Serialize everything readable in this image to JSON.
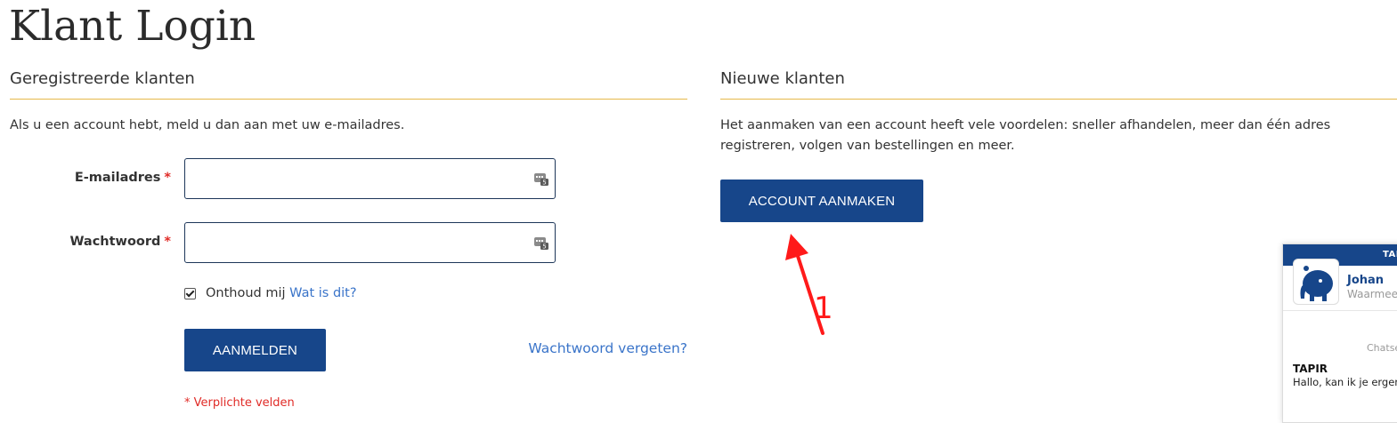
{
  "page": {
    "title": "Klant Login"
  },
  "registered": {
    "heading": "Geregistreerde klanten",
    "intro": "Als u een account hebt, meld u dan aan met uw e-mailadres.",
    "email_label": "E-mailadres",
    "password_label": "Wachtwoord",
    "required_mark": "*",
    "email_value": "",
    "password_value": "",
    "remember_label": "Onthoud mij",
    "remember_checked": true,
    "whats_this_link": "Wat is dit?",
    "login_button": "Aanmelden",
    "forgot_link": "Wachtwoord vergeten?",
    "required_note": "* Verplichte velden"
  },
  "new_customers": {
    "heading": "Nieuwe klanten",
    "intro": "Het aanmaken van een account heeft vele voordelen: sneller afhandelen, meer dan één adres registreren, volgen van bestellingen en meer.",
    "create_button": "Account aanmaken"
  },
  "annotation": {
    "label": "1",
    "color": "#ff1a1a"
  },
  "chat": {
    "header": "TAPIR",
    "agent_name": "Johan",
    "agent_subtitle": "Waarmee kan ik je helpen?",
    "timestamp": "Chatsessie gestart",
    "sender": "TAPIR",
    "message": "Hallo, kan ik je ergens mee helpen?"
  },
  "colors": {
    "accent": "#17468a",
    "divider": "#e6b94a",
    "link": "#3a74c9",
    "required": "#e02b27"
  },
  "icons": [
    "password-manager-icon",
    "checkbox-checked-icon",
    "tapir-avatar-icon",
    "red-arrow-icon"
  ]
}
